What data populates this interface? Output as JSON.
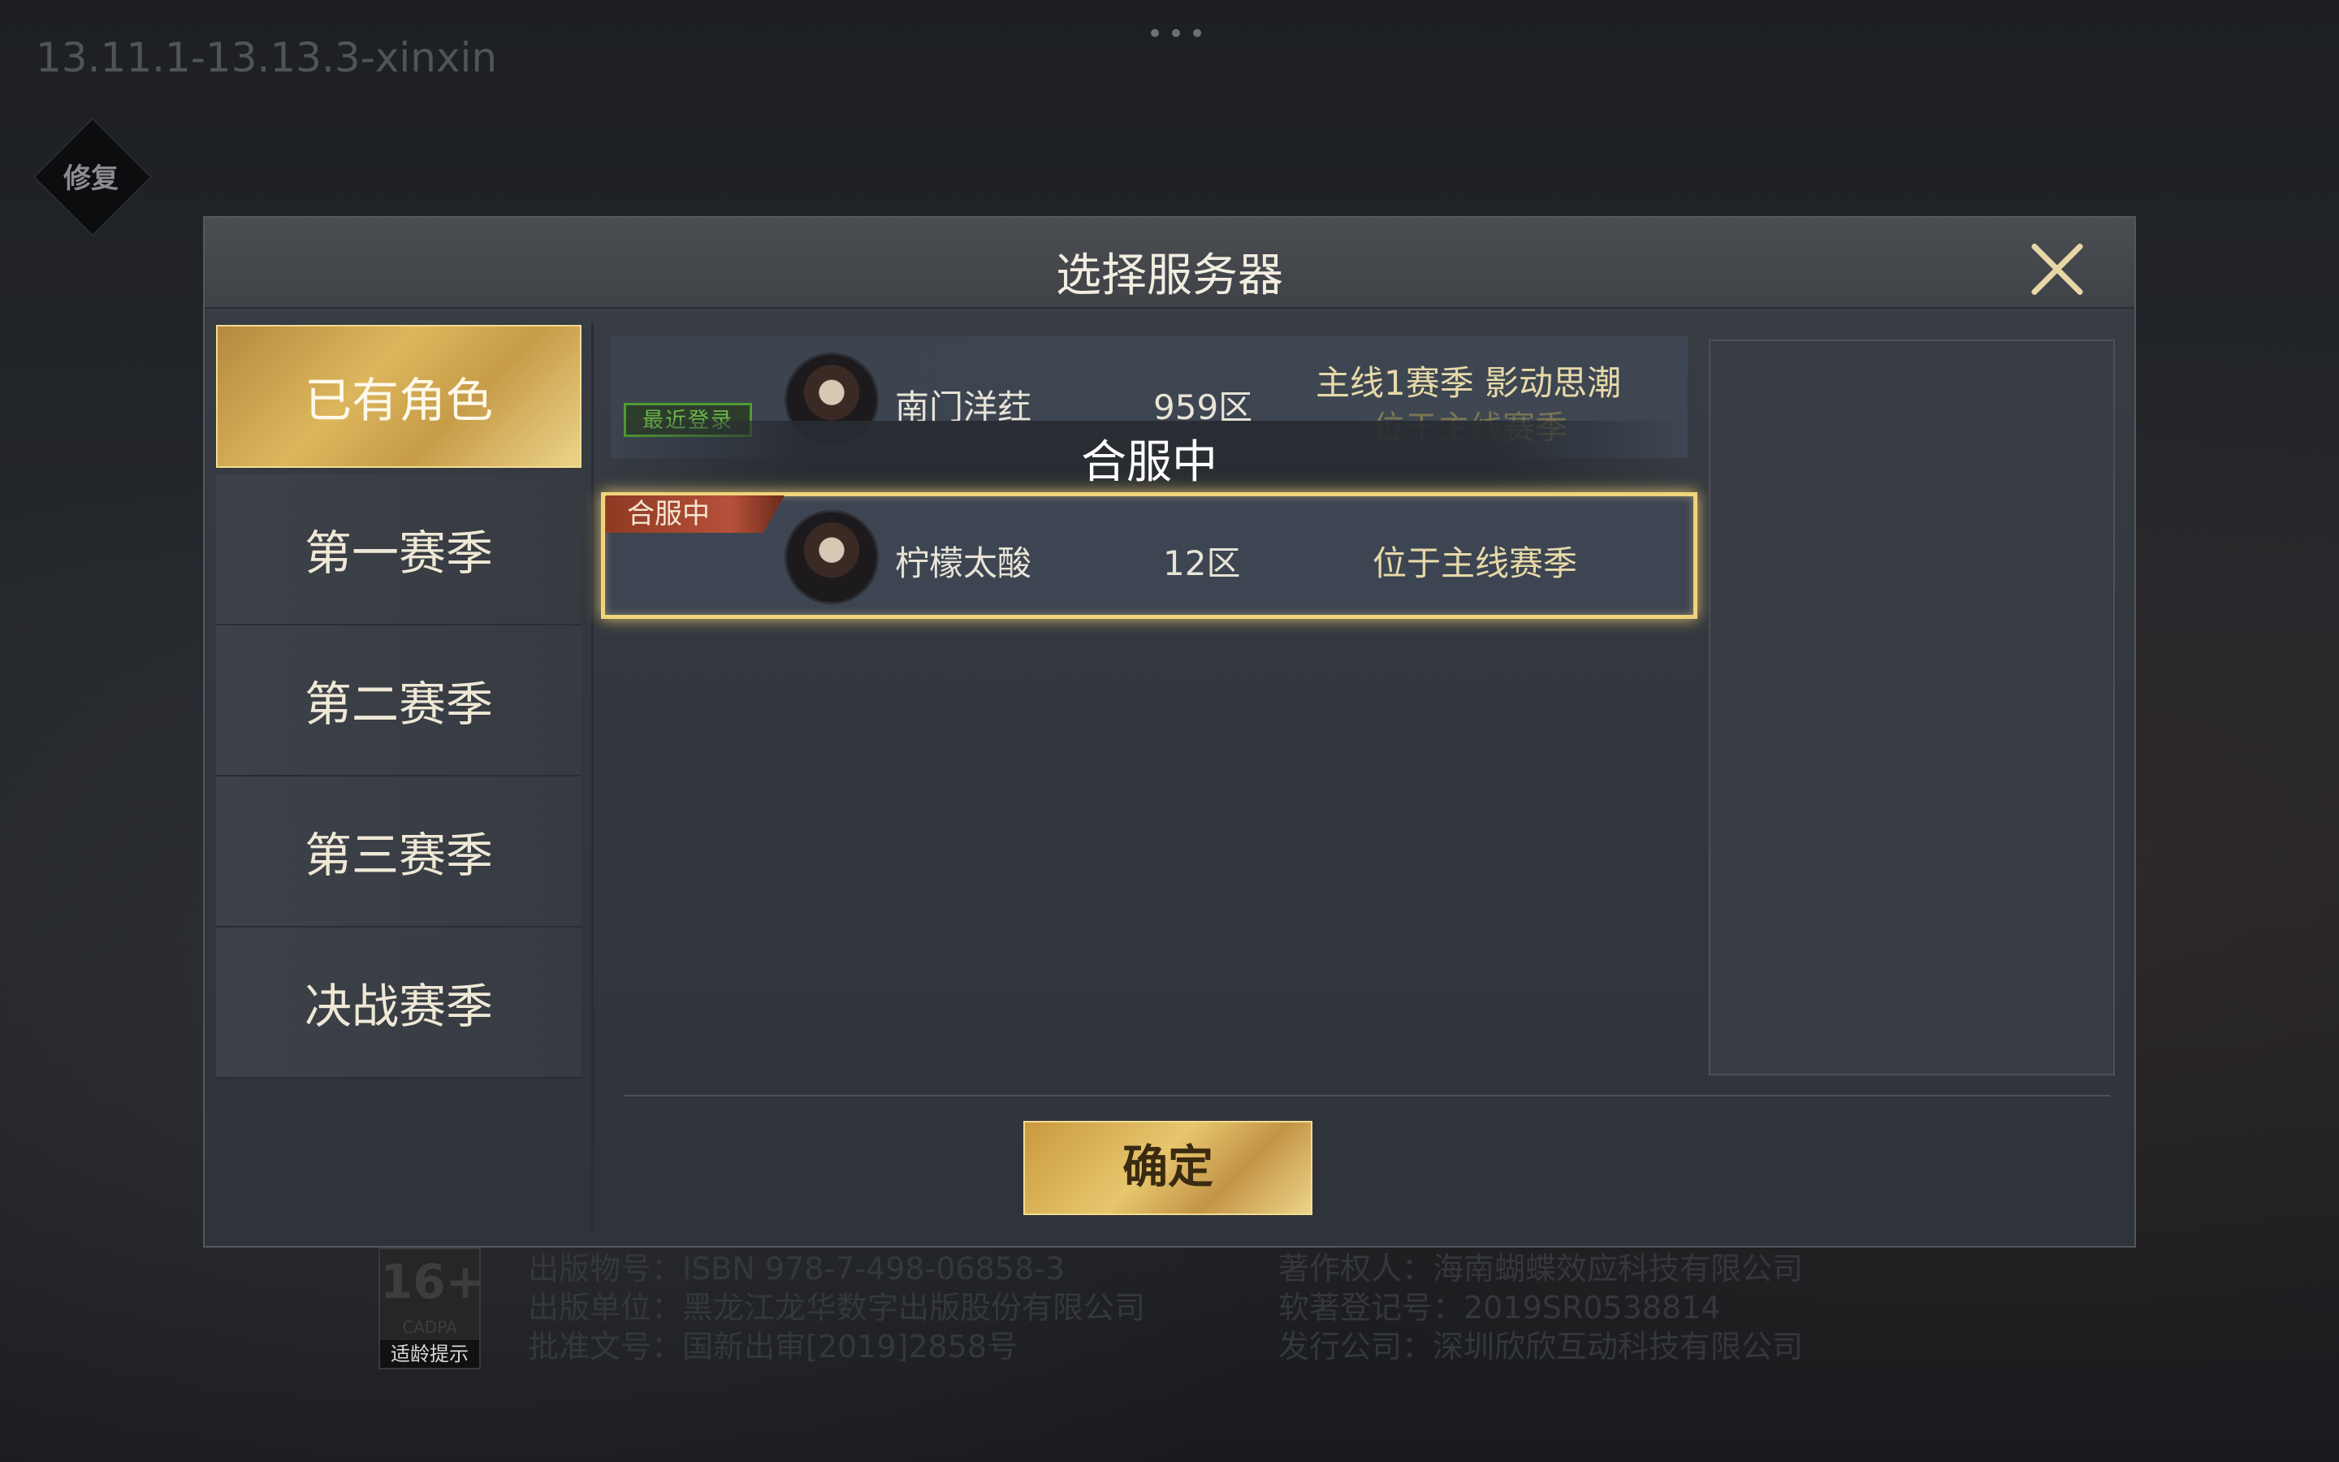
{
  "version": "13.11.1-13.13.3-xinxin",
  "repair_button": "修复",
  "modal": {
    "title": "选择服务器",
    "close_icon": "close-icon"
  },
  "tabs": [
    {
      "label": "已有角色",
      "active": true
    },
    {
      "label": "第一赛季",
      "active": false
    },
    {
      "label": "第二赛季",
      "active": false
    },
    {
      "label": "第三赛季",
      "active": false
    },
    {
      "label": "决战赛季",
      "active": false
    }
  ],
  "servers": [
    {
      "tag": "最近登录",
      "name": "南门洋荭",
      "zone": "959区",
      "status": "主线1赛季 影动思潮",
      "status2": "位于主线赛季"
    },
    {
      "tag": "合服中",
      "name": "柠檬太酸",
      "zone": "12区",
      "status": "位于主线赛季",
      "selected": true
    }
  ],
  "merge_overlay": "合服中",
  "confirm_button": "确定",
  "footer": {
    "age_rating": "16+",
    "age_org": "CADPA",
    "age_tip": "适龄提示",
    "left": [
      "出版物号：ISBN 978-7-498-06858-3",
      "出版单位：黑龙江龙华数字出版股份有限公司",
      "批准文号：国新出审[2019]2858号"
    ],
    "right": [
      "著作权人：海南蝴蝶效应科技有限公司",
      "软著登记号：2019SR0538814",
      "发行公司：深圳欣欣互动科技有限公司"
    ]
  },
  "colors": {
    "gold": "#dcb65d",
    "highlight_border": "#f1d47a",
    "merge_tag": "#b6503a",
    "recent_tag": "#4f9c34"
  }
}
